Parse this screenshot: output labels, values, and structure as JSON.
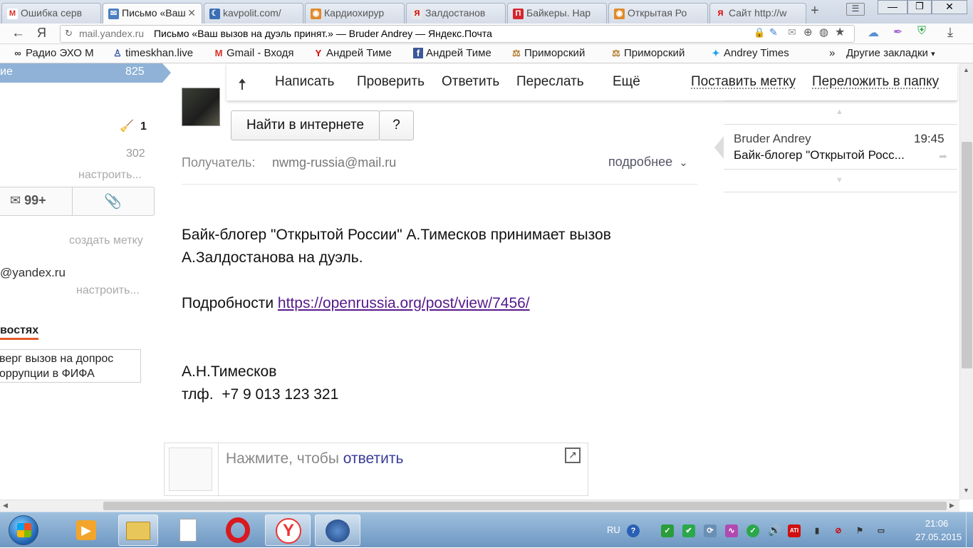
{
  "browser": {
    "tabs": [
      {
        "label": "Ошибка серв",
        "icon": "gmail-icon",
        "color": "#d93025",
        "glyph": "M"
      },
      {
        "label": "Письмо «Ваш",
        "icon": "yandex-mail-icon",
        "color": "#4a7fc1",
        "glyph": "✉"
      },
      {
        "label": "kavpolit.com/",
        "icon": "moon-icon",
        "color": "#3a6fb5",
        "glyph": "☾"
      },
      {
        "label": "Кардиохирур",
        "icon": "site-icon",
        "color": "#e08a2a",
        "glyph": "◉"
      },
      {
        "label": "Залдостанов",
        "icon": "yandex-icon",
        "color": "#e0e0e0",
        "glyph": "Я"
      },
      {
        "label": "Байкеры. Нар",
        "icon": "pikabu-icon",
        "color": "#d6262d",
        "glyph": "П"
      },
      {
        "label": "Открытая Ро",
        "icon": "site-icon",
        "color": "#e08a2a",
        "glyph": "◉"
      },
      {
        "label": "Сайт http://w",
        "icon": "yandex-icon",
        "color": "#ffffff",
        "glyph": "Я"
      }
    ],
    "active_tab": 1,
    "address": {
      "domain": "mail.yandex.ru",
      "title": "Письмо «Ваш вызов на дуэль принят.» — Bruder Andrey — Яндекс.Почта"
    },
    "bookmarks": [
      {
        "label": "Радио ЭХО М",
        "icon": "echo-icon"
      },
      {
        "label": "timeskhan.live",
        "icon": "person-icon"
      },
      {
        "label": "Gmail - Входя",
        "icon": "gmail-icon"
      },
      {
        "label": "Андрей Тиме",
        "icon": "yandex-icon"
      },
      {
        "label": "Андрей Тиме",
        "icon": "facebook-icon"
      },
      {
        "label": "Приморский",
        "icon": "scales-icon"
      },
      {
        "label": "Приморский",
        "icon": "scales-icon"
      },
      {
        "label": "Andrey Times",
        "icon": "twitter-icon"
      }
    ],
    "bookmarks_more": "»",
    "other_bookmarks": "Другие закладки"
  },
  "sidebar": {
    "inbox_label": "ие",
    "inbox_count": "825",
    "broom_count": "1",
    "count_302": "302",
    "configure_1": "настроить...",
    "mail_badge": "99+",
    "create_label": "создать метку",
    "email_partial": "@yandex.ru",
    "configure_2": "настроить...",
    "news_heading": "востях",
    "news_item": "верг вызов на допрос\nоррупции в ФИФА"
  },
  "toolbar": {
    "compose": "Написать",
    "check": "Проверить",
    "reply": "Ответить",
    "forward": "Переслать",
    "more": "Ещё",
    "set_label": "Поставить метку",
    "move_to_folder": "Переложить в папку"
  },
  "message": {
    "search_button": "Найти в интернете",
    "help_button": "?",
    "recipient_label": "Получатель:",
    "recipient_value": "nwmg-russia@mail.ru",
    "details": "подробнее",
    "line1": "Байк-блогер \"Открытой России\" А.Тимесков принимает вызов",
    "line2": "А.Залдостанова на дуэль.",
    "details_prefix": "Подробности ",
    "link": "https://openrussia.org/post/view/7456/",
    "signature_name": "А.Н.Тимесков",
    "signature_phone": "тлф.  +7 9 013 123 321",
    "reply_hint_prefix": "Нажмите, чтобы ",
    "reply_hint_link": "ответить"
  },
  "thread": {
    "sender": "Bruder Andrey",
    "time": "19:45",
    "subject": "Байк-блогер \"Открытой Росс..."
  },
  "taskbar": {
    "lang": "RU",
    "time": "21:06",
    "date": "27.05.2015"
  },
  "colors": {
    "link": "#551a8b",
    "accent": "#8fb2d6",
    "reply_link": "#3a3a9a"
  }
}
